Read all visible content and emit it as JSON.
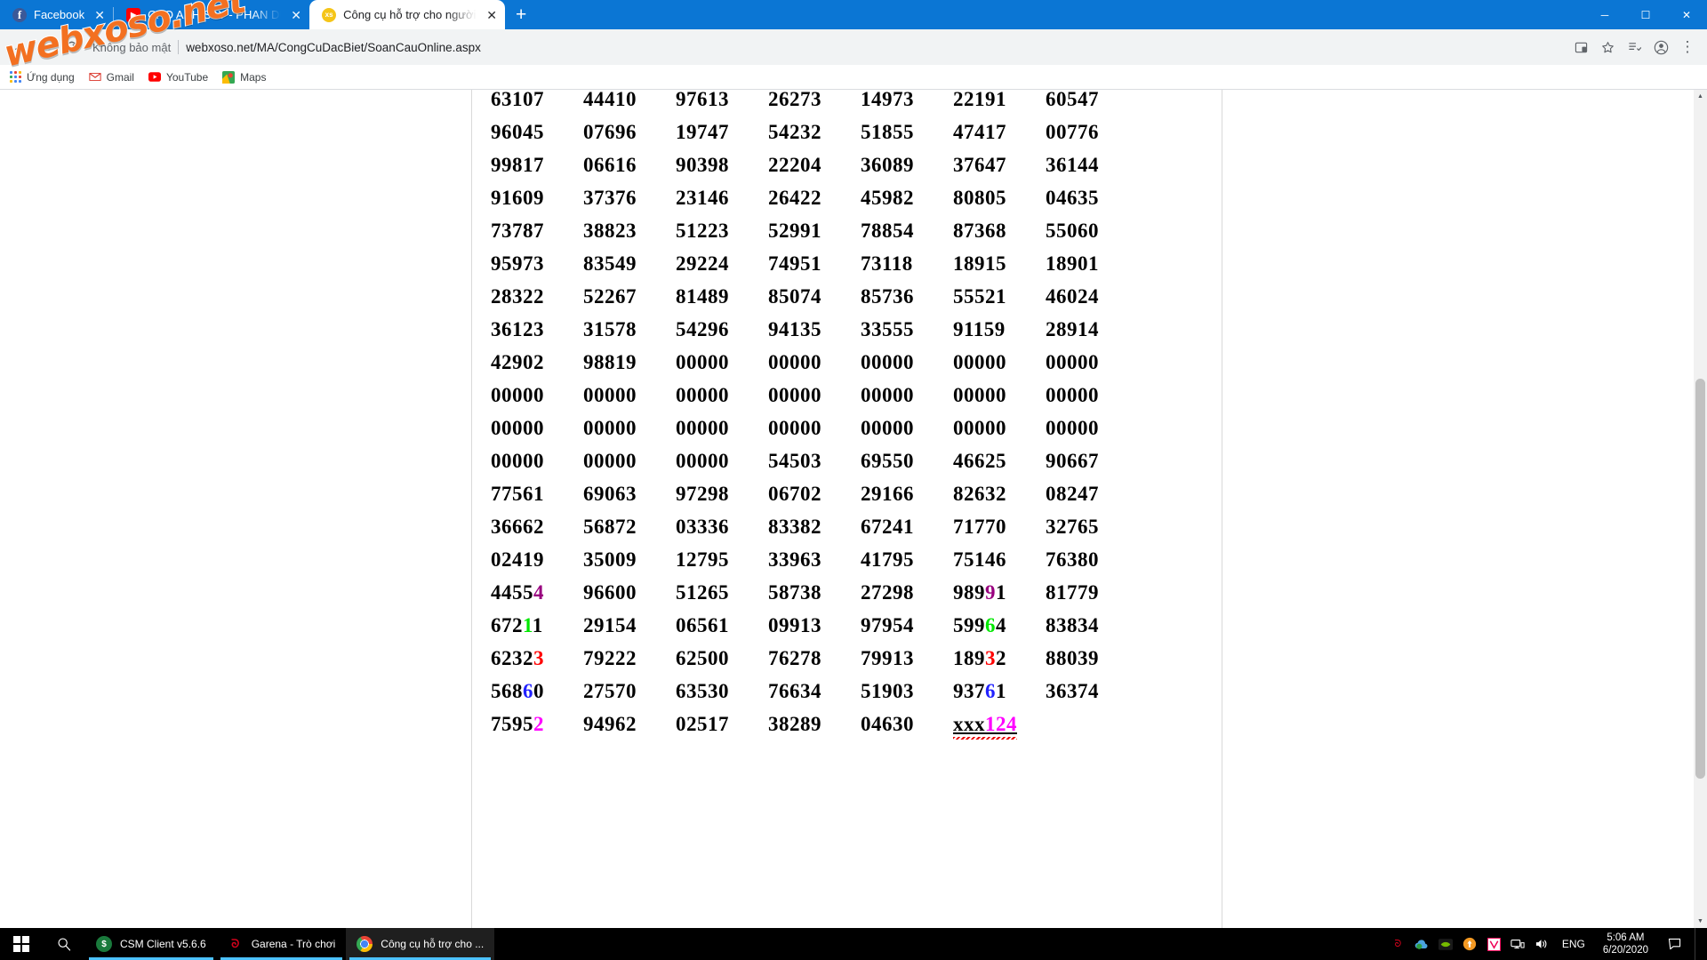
{
  "browser": {
    "tabs": [
      {
        "title": "Facebook",
        "favicon": "facebook-icon",
        "active": false
      },
      {
        "title": "CHO ANH SAY - PHAN DUY ANH",
        "favicon": "youtube-icon",
        "active": false
      },
      {
        "title": "Công cụ hỗ trợ cho người chơi xổ",
        "favicon": "webxoso-icon",
        "active": true
      }
    ],
    "new_tab_label": "+",
    "window_controls": {
      "minimize": "─",
      "maximize": "☐",
      "close": "✕"
    },
    "toolbar": {
      "back": "←",
      "forward": "→",
      "reload": "⟳",
      "security_text": "Không bảo mật",
      "url": "webxoso.net/MA/CongCuDacBiet/SoanCauOnline.aspx",
      "install_icon": "install-app-icon",
      "bookmark_icon": "star-icon",
      "reading_list_icon": "reading-list-icon",
      "profile_icon": "profile-avatar-icon",
      "menu_icon": "three-dot-menu-icon"
    },
    "bookmarks": [
      {
        "label": "Ứng dụng",
        "icon": "apps-grid-icon"
      },
      {
        "label": "Gmail",
        "icon": "gmail-icon"
      },
      {
        "label": "YouTube",
        "icon": "youtube-icon"
      },
      {
        "label": "Maps",
        "icon": "maps-icon"
      }
    ]
  },
  "watermark": {
    "text": "webxoso.net",
    "color": "#f37021"
  },
  "colors": {
    "magenta_dark": "#99007f",
    "green": "#00e800",
    "red": "#ff0000",
    "blue": "#2222ff",
    "magenta": "#ff00ff",
    "tab_blue": "#0b76d4",
    "taskbar": "#000000"
  },
  "grid": {
    "columns": 7,
    "rows": [
      {
        "cells": [
          {
            "text": "63107"
          },
          {
            "text": "44410"
          },
          {
            "text": "97613"
          },
          {
            "text": "26273"
          },
          {
            "text": "14973"
          },
          {
            "text": "22191"
          },
          {
            "text": "60547"
          }
        ]
      },
      {
        "cells": [
          {
            "text": "96045"
          },
          {
            "text": "07696"
          },
          {
            "text": "19747"
          },
          {
            "text": "54232"
          },
          {
            "text": "51855"
          },
          {
            "text": "47417"
          },
          {
            "text": "00776"
          }
        ]
      },
      {
        "cells": [
          {
            "text": "99817"
          },
          {
            "text": "06616"
          },
          {
            "text": "90398"
          },
          {
            "text": "22204"
          },
          {
            "text": "36089"
          },
          {
            "text": "37647"
          },
          {
            "text": "36144"
          }
        ]
      },
      {
        "cells": [
          {
            "text": "91609"
          },
          {
            "text": "37376"
          },
          {
            "text": "23146"
          },
          {
            "text": "26422"
          },
          {
            "text": "45982"
          },
          {
            "text": "80805"
          },
          {
            "text": "04635"
          }
        ]
      },
      {
        "cells": [
          {
            "text": "73787"
          },
          {
            "text": "38823"
          },
          {
            "text": "51223"
          },
          {
            "text": "52991"
          },
          {
            "text": "78854"
          },
          {
            "text": "87368"
          },
          {
            "text": "55060"
          }
        ]
      },
      {
        "cells": [
          {
            "text": "95973"
          },
          {
            "text": "83549"
          },
          {
            "text": "29224"
          },
          {
            "text": "74951"
          },
          {
            "text": "73118"
          },
          {
            "text": "18915"
          },
          {
            "text": "18901"
          }
        ]
      },
      {
        "cells": [
          {
            "text": "28322"
          },
          {
            "text": "52267"
          },
          {
            "text": "81489"
          },
          {
            "text": "85074"
          },
          {
            "text": "85736"
          },
          {
            "text": "55521"
          },
          {
            "text": "46024"
          }
        ]
      },
      {
        "cells": [
          {
            "text": "36123"
          },
          {
            "text": "31578"
          },
          {
            "text": "54296"
          },
          {
            "text": "94135"
          },
          {
            "text": "33555"
          },
          {
            "text": "91159"
          },
          {
            "text": "28914"
          }
        ]
      },
      {
        "cells": [
          {
            "text": "42902"
          },
          {
            "text": "98819"
          },
          {
            "text": "00000"
          },
          {
            "text": "00000"
          },
          {
            "text": "00000"
          },
          {
            "text": "00000"
          },
          {
            "text": "00000"
          }
        ]
      },
      {
        "cells": [
          {
            "text": "00000"
          },
          {
            "text": "00000"
          },
          {
            "text": "00000"
          },
          {
            "text": "00000"
          },
          {
            "text": "00000"
          },
          {
            "text": "00000"
          },
          {
            "text": "00000"
          }
        ]
      },
      {
        "cells": [
          {
            "text": "00000"
          },
          {
            "text": "00000"
          },
          {
            "text": "00000"
          },
          {
            "text": "00000"
          },
          {
            "text": "00000"
          },
          {
            "text": "00000"
          },
          {
            "text": "00000"
          }
        ]
      },
      {
        "cells": [
          {
            "text": "00000"
          },
          {
            "text": "00000"
          },
          {
            "text": "00000"
          },
          {
            "text": "54503"
          },
          {
            "text": "69550"
          },
          {
            "text": "46625"
          },
          {
            "text": "90667"
          }
        ]
      },
      {
        "cells": [
          {
            "text": "77561"
          },
          {
            "text": "69063"
          },
          {
            "text": "97298"
          },
          {
            "text": "06702"
          },
          {
            "text": "29166"
          },
          {
            "text": "82632"
          },
          {
            "text": "08247"
          }
        ]
      },
      {
        "cells": [
          {
            "text": "36662"
          },
          {
            "text": "56872"
          },
          {
            "text": "03336"
          },
          {
            "text": "83382"
          },
          {
            "text": "67241"
          },
          {
            "text": "71770"
          },
          {
            "text": "32765"
          }
        ]
      },
      {
        "cells": [
          {
            "text": "02419"
          },
          {
            "text": "35009"
          },
          {
            "text": "12795"
          },
          {
            "text": "33963"
          },
          {
            "text": "41795"
          },
          {
            "text": "75146"
          },
          {
            "text": "76380"
          }
        ]
      },
      {
        "cells": [
          {
            "text": "44554",
            "highlight": {
              "index": 4,
              "color": "magenta_dark"
            }
          },
          {
            "text": "96600"
          },
          {
            "text": "51265"
          },
          {
            "text": "58738"
          },
          {
            "text": "27298"
          },
          {
            "text": "98991",
            "highlight": {
              "index": 3,
              "color": "magenta_dark"
            }
          },
          {
            "text": "81779"
          }
        ]
      },
      {
        "cells": [
          {
            "text": "67211",
            "highlight": {
              "index": 3,
              "color": "green"
            }
          },
          {
            "text": "29154"
          },
          {
            "text": "06561"
          },
          {
            "text": "09913"
          },
          {
            "text": "97954"
          },
          {
            "text": "59964",
            "highlight": {
              "index": 3,
              "color": "green"
            }
          },
          {
            "text": "83834"
          }
        ]
      },
      {
        "cells": [
          {
            "text": "62323",
            "highlight": {
              "index": 4,
              "color": "red"
            }
          },
          {
            "text": "79222"
          },
          {
            "text": "62500"
          },
          {
            "text": "76278"
          },
          {
            "text": "79913"
          },
          {
            "text": "18932",
            "highlight": {
              "index": 3,
              "color": "red"
            }
          },
          {
            "text": "88039"
          }
        ]
      },
      {
        "cells": [
          {
            "text": "56860",
            "highlight": {
              "index": 3,
              "color": "blue"
            }
          },
          {
            "text": "27570"
          },
          {
            "text": "63530"
          },
          {
            "text": "76634"
          },
          {
            "text": "51903"
          },
          {
            "text": "93761",
            "highlight": {
              "index": 3,
              "color": "blue"
            }
          },
          {
            "text": "36374"
          }
        ]
      },
      {
        "cells": [
          {
            "text": "75952",
            "highlight": {
              "index": 4,
              "color": "magenta"
            }
          },
          {
            "text": "94962"
          },
          {
            "text": "02517"
          },
          {
            "text": "38289"
          },
          {
            "text": "04630"
          },
          {
            "text": "xxx124",
            "spell_error": true,
            "highlight": {
              "start": 3,
              "color": "magenta"
            }
          },
          {
            "text": ""
          }
        ]
      }
    ]
  },
  "taskbar": {
    "start_icon": "windows-start-icon",
    "search_icon": "search-icon",
    "tasks": [
      {
        "label": "CSM Client v5.6.6",
        "icon": "csm-client-icon",
        "active": false
      },
      {
        "label": "Garena - Trò chơi",
        "icon": "garena-icon",
        "active": false
      },
      {
        "label": "Công cụ hỗ trợ cho ...",
        "icon": "chrome-icon",
        "active": true
      }
    ],
    "tray_icons": [
      "garena-tray-icon",
      "cloud-sync-icon",
      "nvidia-icon",
      "update-icon",
      "vpn-icon",
      "network-icon",
      "volume-icon"
    ],
    "language": "ENG",
    "time": "5:06 AM",
    "date": "6/20/2020",
    "notification_icon": "notification-icon"
  }
}
